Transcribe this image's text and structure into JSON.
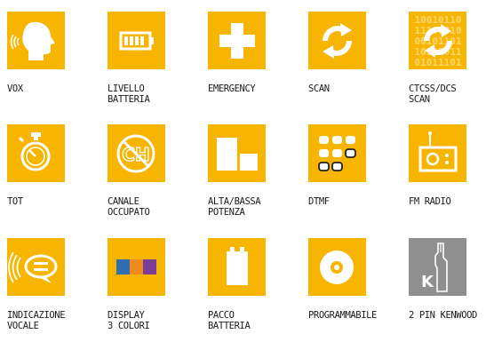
{
  "colors": {
    "tile": "#f7b500",
    "tile_grey": "#8f8f8f",
    "icon": "#ffffff",
    "text": "#1a1a1a"
  },
  "features": [
    {
      "id": "vox",
      "label": "VOX",
      "icon": "speaking-head-icon"
    },
    {
      "id": "battery-level",
      "label": "LIVELLO\nBATTERIA",
      "icon": "battery-level-icon"
    },
    {
      "id": "emergency",
      "label": "EMERGENCY",
      "icon": "plus-cross-icon"
    },
    {
      "id": "scan",
      "label": "SCAN",
      "icon": "circular-arrows-icon"
    },
    {
      "id": "ctcss-dcs-scan",
      "label": "CTCSS/DCS\nSCAN",
      "icon": "binary-scan-icon",
      "binary": [
        "10010110",
        "11100010",
        "00101101",
        "10101011",
        "01011101"
      ]
    },
    {
      "id": "tot",
      "label": "TOT",
      "icon": "stopwatch-icon"
    },
    {
      "id": "busy-channel",
      "label": "CANALE\nOCCUPATO",
      "icon": "channel-prohibited-icon",
      "glyph": "CH"
    },
    {
      "id": "power",
      "label": "ALTA/BASSA\nPOTENZA",
      "icon": "high-low-power-icon"
    },
    {
      "id": "dtmf",
      "label": "DTMF",
      "icon": "keypad-icon"
    },
    {
      "id": "fm-radio",
      "label": "FM RADIO",
      "icon": "radio-icon"
    },
    {
      "id": "voice-prompt",
      "label": "INDICAZIONE\nVOCALE",
      "icon": "voice-bubble-icon"
    },
    {
      "id": "display",
      "label": "DISPLAY\n3 COLORI",
      "icon": "color-bars-icon",
      "bar_colors": [
        "#2f6fb0",
        "#f08a1c",
        "#7a3e98"
      ]
    },
    {
      "id": "battery-pack",
      "label": "PACCO\nBATTERIA",
      "icon": "battery-pack-icon"
    },
    {
      "id": "programmable",
      "label": "PROGRAMMABILE",
      "icon": "disc-icon"
    },
    {
      "id": "kenwood",
      "label": "2 PIN KENWOOD",
      "icon": "kenwood-plug-icon",
      "glyph": "K"
    }
  ]
}
